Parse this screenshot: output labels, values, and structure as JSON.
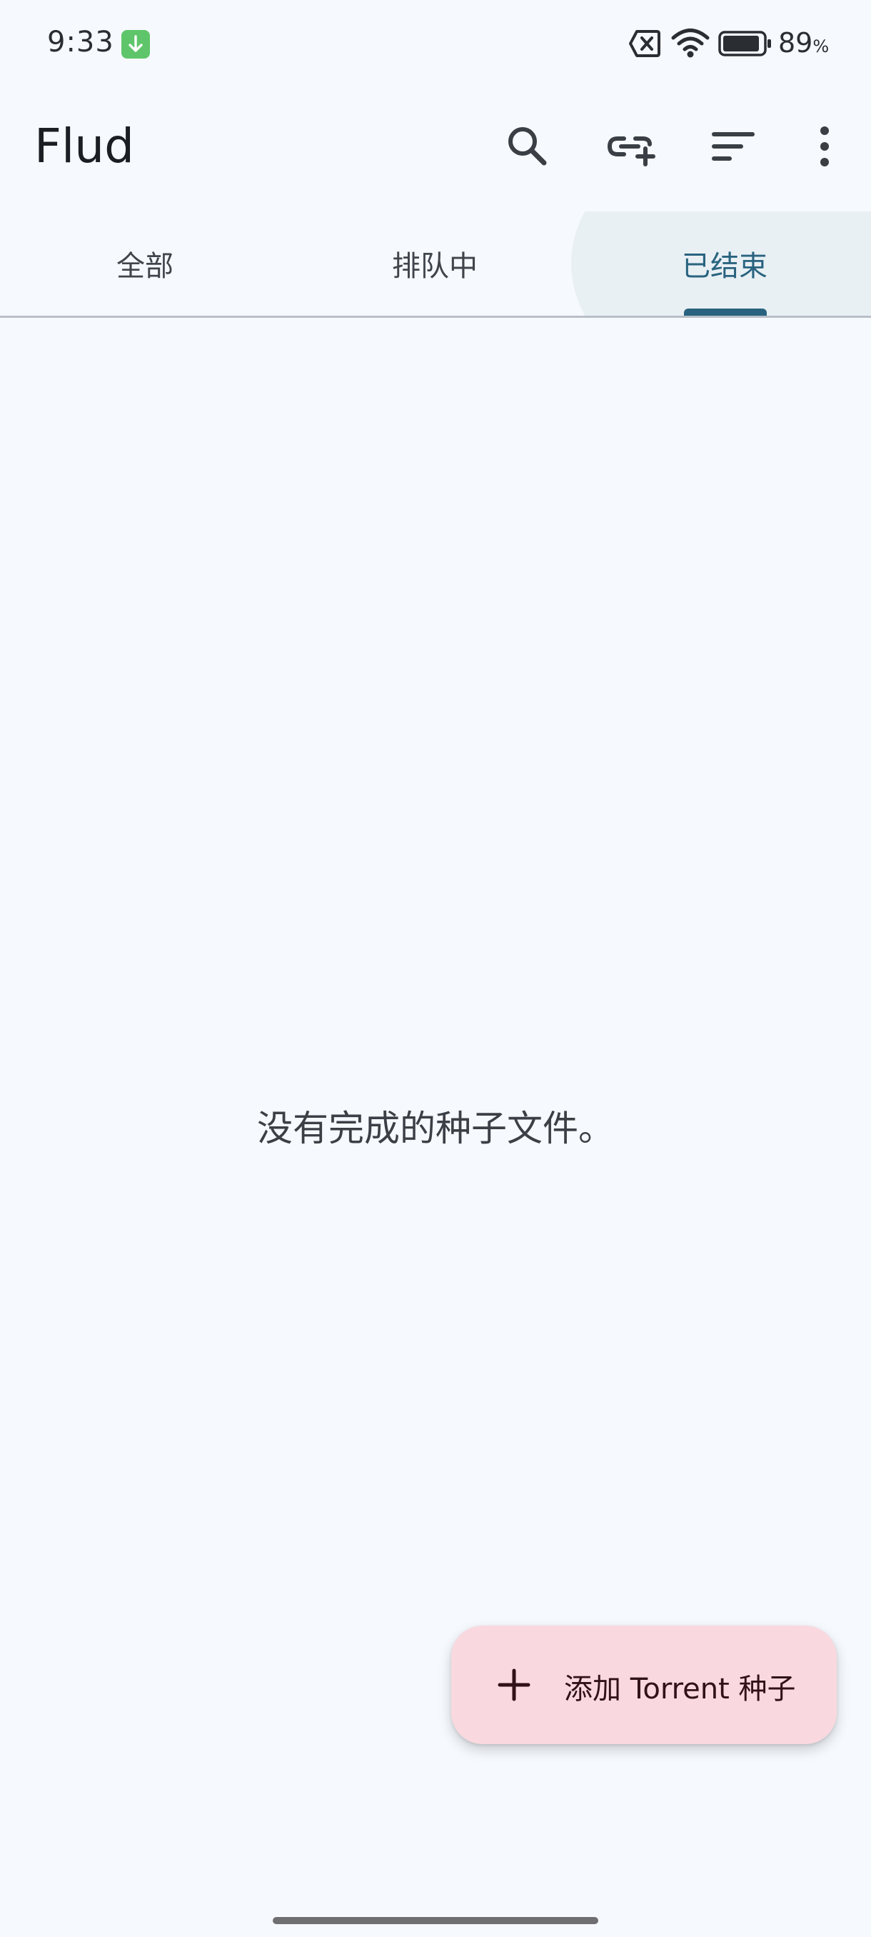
{
  "status_bar": {
    "time": "9:33",
    "notification_icon": "download-arrow-icon",
    "icons": [
      "no-sim-icon",
      "wifi-icon",
      "battery-icon"
    ],
    "battery_percent": "89",
    "battery_unit": "%"
  },
  "app_bar": {
    "title": "Flud",
    "actions": [
      "search-icon",
      "add-link-icon",
      "sort-icon",
      "more-vert-icon"
    ]
  },
  "tabs": [
    {
      "label": "全部",
      "selected": false
    },
    {
      "label": "排队中",
      "selected": false
    },
    {
      "label": "已结束",
      "selected": true
    }
  ],
  "main": {
    "empty_message": "没有完成的种子文件。"
  },
  "fab": {
    "icon": "plus-icon",
    "label": "添加 Torrent 种子"
  },
  "colors": {
    "background": "#f6f9fe",
    "accent": "#29637f",
    "fab_background": "#f9d9df"
  }
}
